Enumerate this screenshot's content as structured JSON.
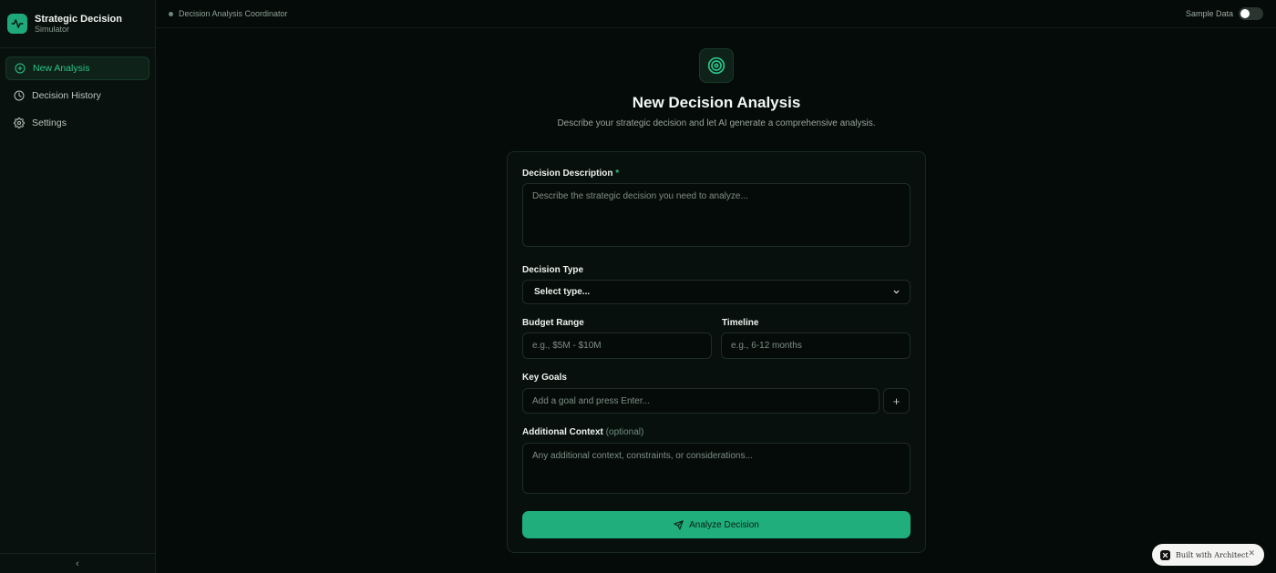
{
  "sidebar": {
    "brand_title": "Strategic Decision",
    "brand_subtitle": "Simulator",
    "brand_icon": "activity-icon",
    "items": [
      {
        "label": "New Analysis",
        "icon": "plus-circle-icon",
        "active": true
      },
      {
        "label": "Decision History",
        "icon": "clock-icon",
        "active": false
      },
      {
        "label": "Settings",
        "icon": "gear-icon",
        "active": false
      }
    ],
    "collapse_glyph": "‹"
  },
  "topbar": {
    "crumb": "Decision Analysis Coordinator",
    "sample_label": "Sample Data",
    "sample_enabled": false
  },
  "header": {
    "icon": "target-icon",
    "title": "New Decision Analysis",
    "subtitle": "Describe your strategic decision and let AI generate a comprehensive analysis."
  },
  "form": {
    "description": {
      "label": "Decision Description",
      "required_mark": "*",
      "placeholder": "Describe the strategic decision you need to analyze...",
      "value": ""
    },
    "type": {
      "label": "Decision Type",
      "selected": "Select type..."
    },
    "budget": {
      "label": "Budget Range",
      "placeholder": "e.g., $5M - $10M",
      "value": ""
    },
    "timeline": {
      "label": "Timeline",
      "placeholder": "e.g., 6-12 months",
      "value": ""
    },
    "goals": {
      "label": "Key Goals",
      "placeholder": "Add a goal and press Enter...",
      "add_glyph": "+"
    },
    "context": {
      "label": "Additional Context",
      "optional_text": "(optional)",
      "placeholder": "Any additional context, constraints, or considerations..."
    },
    "submit_label": "Analyze Decision"
  },
  "badge": {
    "label": "Built with Architect",
    "close_glyph": "✕"
  },
  "colors": {
    "accent": "#1fae7c",
    "accent_text": "#28c48a",
    "background": "#050b08"
  }
}
